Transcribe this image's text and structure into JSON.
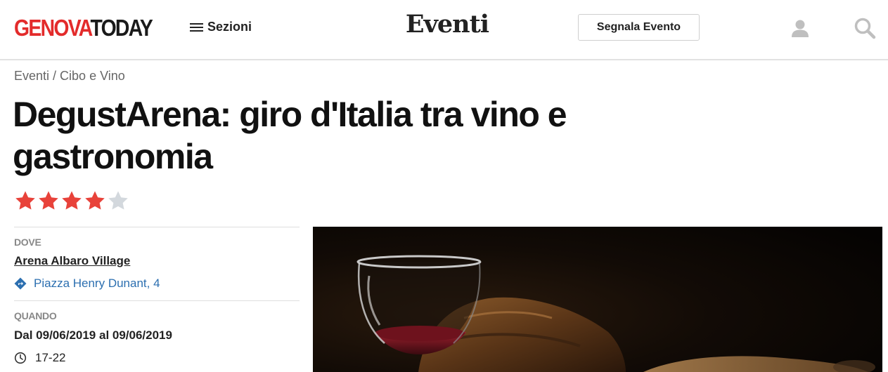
{
  "header": {
    "logo_part1": "GENOVA",
    "logo_part2": "TODAY",
    "menu_label": "Sezioni",
    "section_title": "Eventi",
    "report_button": "Segnala Evento"
  },
  "icons": {
    "menu": "hamburger-icon",
    "user": "user-icon",
    "search": "search-icon",
    "location": "directions-icon",
    "time": "clock-icon",
    "rating": "star-icon"
  },
  "breadcrumb": {
    "part1": "Eventi",
    "separator": " / ",
    "part2": "Cibo e Vino"
  },
  "event": {
    "title": "DegustArena: giro d'Italia tra vino e gastronomia",
    "rating": 4,
    "rating_max": 5
  },
  "info": {
    "where_label": "DOVE",
    "venue": "Arena Albaro Village",
    "address": "Piazza Henry Dunant, 4",
    "when_label": "QUANDO",
    "dates": "Dal 09/06/2019 al 09/06/2019",
    "hours": "17-22"
  },
  "colors": {
    "brand_red": "#e32b2b",
    "star_on": "#e8423a",
    "star_off": "#d3d8dd",
    "link_blue": "#2c6fb0"
  }
}
